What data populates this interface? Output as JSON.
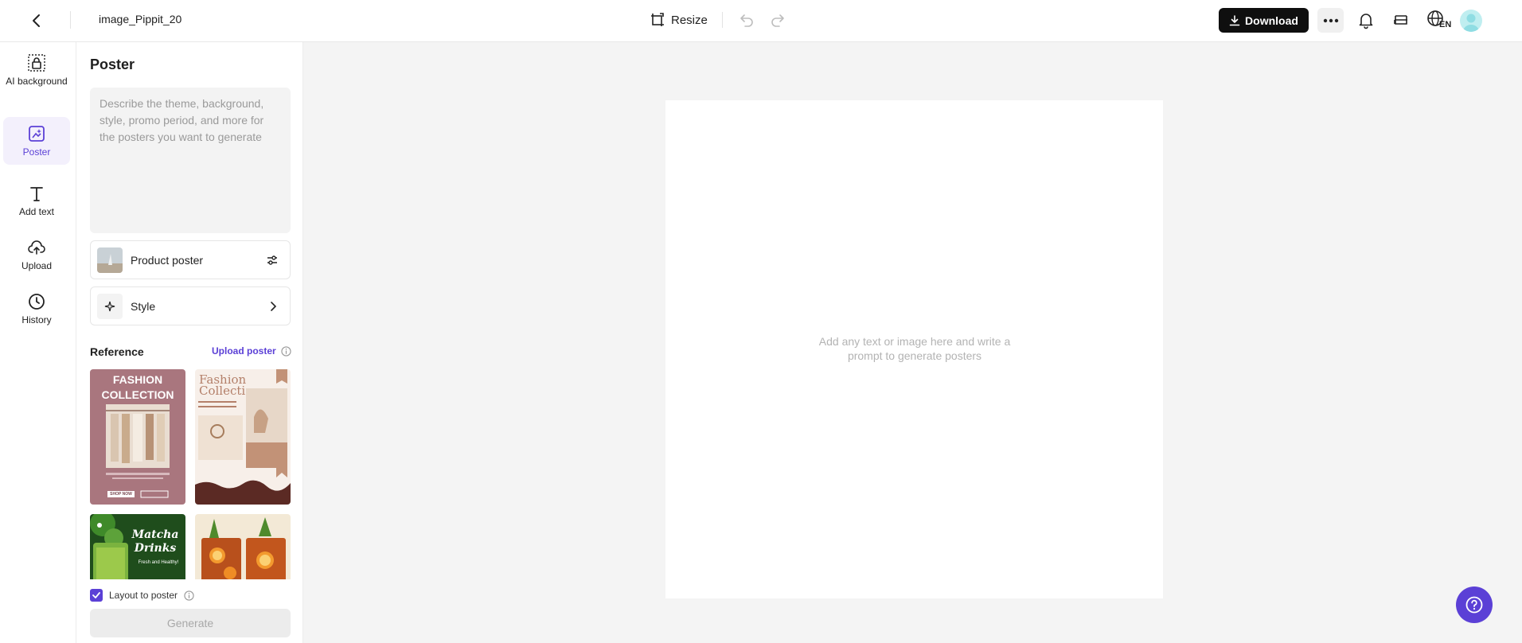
{
  "header": {
    "file_name": "image_Pippit_20",
    "resize_label": "Resize",
    "download_label": "Download",
    "language_code": "EN"
  },
  "rail": {
    "items": [
      {
        "label": "AI background",
        "icon": "ai-background-icon"
      },
      {
        "label": "Poster",
        "icon": "poster-icon"
      },
      {
        "label": "Add text",
        "icon": "text-icon"
      },
      {
        "label": "Upload",
        "icon": "upload-cloud-icon"
      },
      {
        "label": "History",
        "icon": "clock-icon"
      }
    ],
    "active": "Poster"
  },
  "panel": {
    "title": "Poster",
    "prompt_placeholder": "Describe the theme, background, style, promo period, and more for the posters you want to generate",
    "product_poster_label": "Product poster",
    "style_label": "Style",
    "reference_title": "Reference",
    "upload_poster_label": "Upload poster",
    "thumbnails": [
      {
        "title": "FASHION COLLECTION",
        "button": "SHOP NOW"
      },
      {
        "title": "Fashion Collection"
      },
      {
        "title": "Matcha Drinks",
        "subtitle": "Fresh and Healthy!"
      },
      {
        "title": ""
      }
    ],
    "layout_to_poster_label": "Layout to poster",
    "layout_to_poster_checked": true,
    "generate_label": "Generate"
  },
  "canvas": {
    "hint": "Add any text or image here and write a prompt to generate posters"
  },
  "colors": {
    "accent": "#5b40d6",
    "download_bg": "#0f0f0f",
    "canvas_bg": "#f4f4f4"
  }
}
